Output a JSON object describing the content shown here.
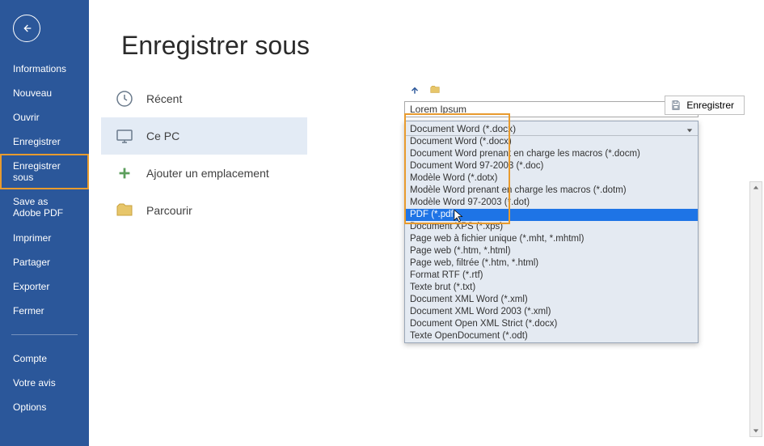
{
  "sidebar": {
    "items": [
      {
        "label": "Informations"
      },
      {
        "label": "Nouveau"
      },
      {
        "label": "Ouvrir"
      },
      {
        "label": "Enregistrer"
      },
      {
        "label": "Enregistrer sous"
      },
      {
        "label": "Save as Adobe PDF"
      },
      {
        "label": "Imprimer"
      },
      {
        "label": "Partager"
      },
      {
        "label": "Exporter"
      },
      {
        "label": "Fermer"
      }
    ],
    "footer": [
      {
        "label": "Compte"
      },
      {
        "label": "Votre avis"
      },
      {
        "label": "Options"
      }
    ]
  },
  "page": {
    "title": "Enregistrer sous"
  },
  "locations": {
    "recent": "Récent",
    "thispc": "Ce PC",
    "addplace": "Ajouter un emplacement",
    "browse": "Parcourir"
  },
  "file": {
    "name": "Lorem Ipsum"
  },
  "filetype": {
    "selected": "Document Word (*.docx)",
    "options": [
      "Document Word (*.docx)",
      "Document Word prenant en charge les macros (*.docm)",
      "Document Word 97-2003 (*.doc)",
      "Modèle Word (*.dotx)",
      "Modèle Word prenant en charge les macros (*.dotm)",
      "Modèle Word 97-2003 (*.dot)",
      "PDF (*.pdf)",
      "Document XPS (*.xps)",
      "Page web à fichier unique (*.mht, *.mhtml)",
      "Page web (*.htm, *.html)",
      "Page web, filtrée (*.htm, *.html)",
      "Format RTF (*.rtf)",
      "Texte brut (*.txt)",
      "Document XML Word (*.xml)",
      "Document XML Word 2003 (*.xml)",
      "Document Open XML Strict (*.docx)",
      "Texte OpenDocument (*.odt)"
    ]
  },
  "buttons": {
    "save": "Enregistrer"
  },
  "colors": {
    "accent": "#2b579a",
    "highlight_orange": "#e89b2e",
    "selection_blue": "#1e74e6"
  }
}
